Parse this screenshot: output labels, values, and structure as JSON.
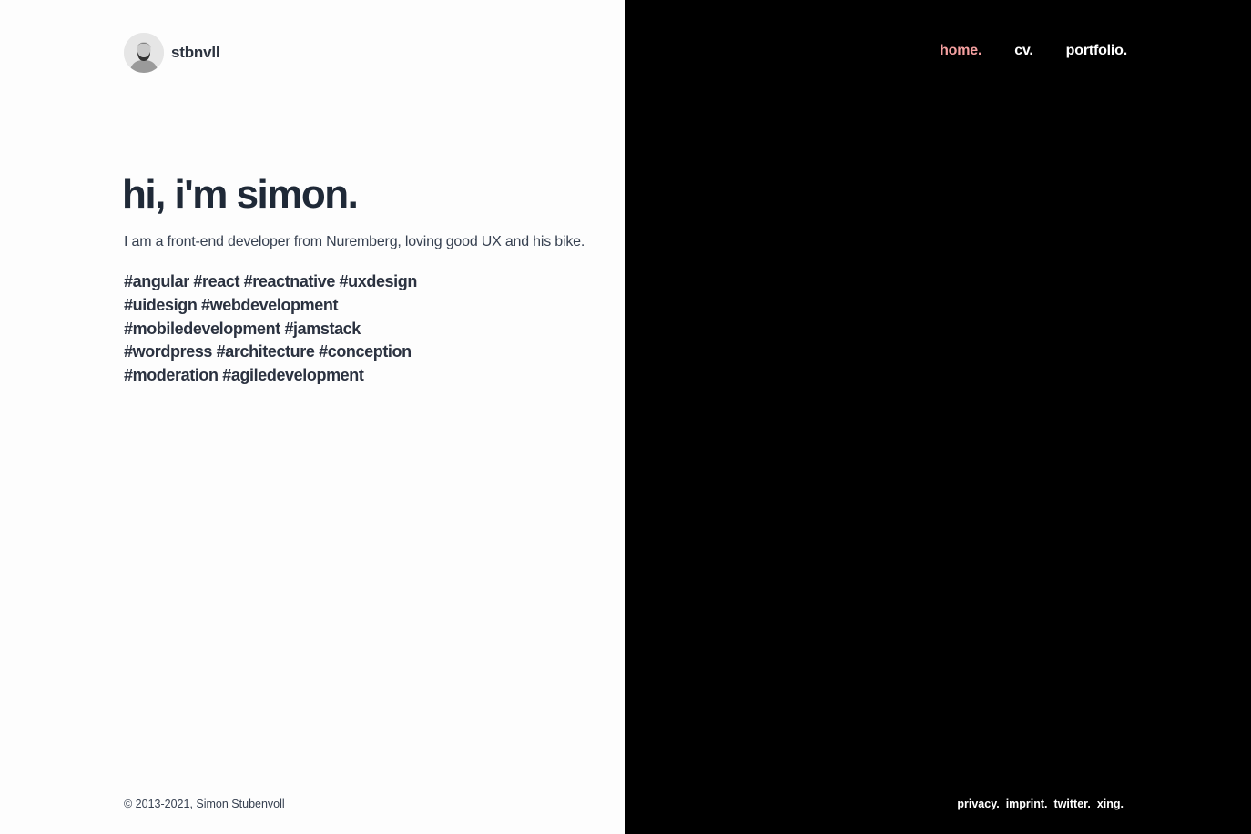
{
  "brand": {
    "name": "stbnvll"
  },
  "nav": {
    "items": [
      {
        "label": "home.",
        "active": true
      },
      {
        "label": "cv.",
        "active": false
      },
      {
        "label": "portfolio.",
        "active": false
      }
    ],
    "active_color": "#f5a0a0"
  },
  "hero": {
    "title": "hi, i'm simon.",
    "description": "I am a front-end developer from Nuremberg, loving good UX and his bike.",
    "tag_lines": [
      "#angular #react #reactnative #uxdesign",
      "#uidesign #webdevelopment",
      "#mobiledevelopment #jamstack",
      "#wordpress #architecture #conception",
      "#moderation #agiledevelopment"
    ]
  },
  "footer": {
    "copyright": "© 2013-2021, Simon Stubenvoll",
    "links": [
      "privacy.",
      "imprint.",
      "twitter.",
      "xing."
    ]
  },
  "colors": {
    "left_background": "#fdfdfd",
    "right_background": "#000000",
    "text_dark": "#1f2937"
  }
}
